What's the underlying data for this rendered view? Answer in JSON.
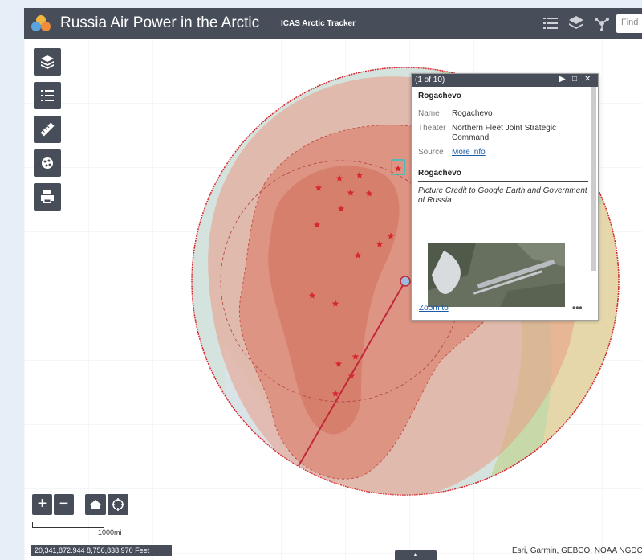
{
  "header": {
    "title": "Russia Air Power in the Arctic",
    "subtitle": "ICAS Arctic Tracker",
    "search_placeholder": "Find",
    "icons": [
      "legend-icon",
      "layers-icon",
      "share-icon"
    ]
  },
  "toolbar": {
    "tools": [
      "layers-icon",
      "legend-icon",
      "measure-icon",
      "basemap-gallery-icon",
      "print-icon"
    ]
  },
  "popup": {
    "count": "(1 of 10)",
    "title": "Rogachevo",
    "fields": [
      {
        "label": "Name",
        "value": "Rogachevo"
      },
      {
        "label": "Theater",
        "value": "Northern Fleet Joint Strategic Command"
      },
      {
        "label": "Source",
        "value": "More info"
      }
    ],
    "media_title": "Rogachevo",
    "media_caption": "Picture Credit to Google Earth and Government of Russia",
    "zoom_to": "Zoom to",
    "more": "•••"
  },
  "map": {
    "zoom_in": "+",
    "zoom_out": "−",
    "scale_label": "1000mi",
    "coordinates": "20,341,872.944 8,756,838.970 Feet",
    "attribution": "Esri, Garmin, GEBCO, NOAA NGDC",
    "marker_color": "#d8262d",
    "range_color": "#e07a5f"
  }
}
